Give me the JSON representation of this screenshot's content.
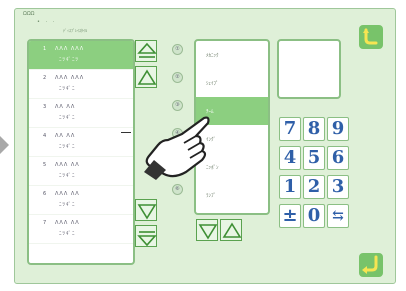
{
  "header": {
    "title": "ΩΩΩ",
    "columns": "•  ·  ·",
    "subtitle": "ﾃﾞｨｽﾌﾟﾚｲｽﾀｲﾙ"
  },
  "list_items": [
    {
      "num": "1",
      "line1": "ΛΛΛ ΛΛΛ",
      "line2": "ﾆﾂｷﾞﾆﾂ"
    },
    {
      "num": "2",
      "line1": "ΛΛΛ ΛΛΛ",
      "line2": "ﾆﾂｷﾞﾆ"
    },
    {
      "num": "3",
      "line1": "ΛΛ  ΛΛ",
      "line2": "ﾆﾂｷﾞﾆ"
    },
    {
      "num": "4",
      "line1": "ΛΛ  ΛΛ",
      "line2": "ﾆﾂｷﾞﾆ"
    },
    {
      "num": "5",
      "line1": "ΛΛΛ ΛΛ",
      "line2": "ﾆﾂｷﾞﾆ"
    },
    {
      "num": "6",
      "line1": "ΛΛΛ ΛΛ",
      "line2": "ﾆﾂｷﾞﾆ"
    },
    {
      "num": "7",
      "line1": "ΛΛΛ ΛΛ",
      "line2": "ﾆﾂｷﾞﾆ"
    },
    {
      "num": "",
      "line1": "",
      "line2": ""
    }
  ],
  "option_numbers": [
    "①",
    "②",
    "③",
    "④",
    "⑤",
    "⑥"
  ],
  "options": [
    "ﾒｶﾆｯｸ",
    "ｼｪｲﾌﾟ",
    "ﾁｰﾑ",
    "ｲﾝｸﾞ",
    "ﾆｯﾎﾟﾝ",
    "ﾗﾝﾌﾟ"
  ],
  "keypad": {
    "row1": [
      "7",
      "8",
      "9"
    ],
    "row2": [
      "4",
      "5",
      "6"
    ],
    "row3": [
      "1",
      "2",
      "3"
    ],
    "row4": [
      "±",
      "0",
      "⇆"
    ]
  },
  "colors": {
    "screen_bg": "#dff0d8",
    "selection": "#8ccf80",
    "key_digit": "#2f5fa8",
    "accent_button": "#78c36a"
  }
}
